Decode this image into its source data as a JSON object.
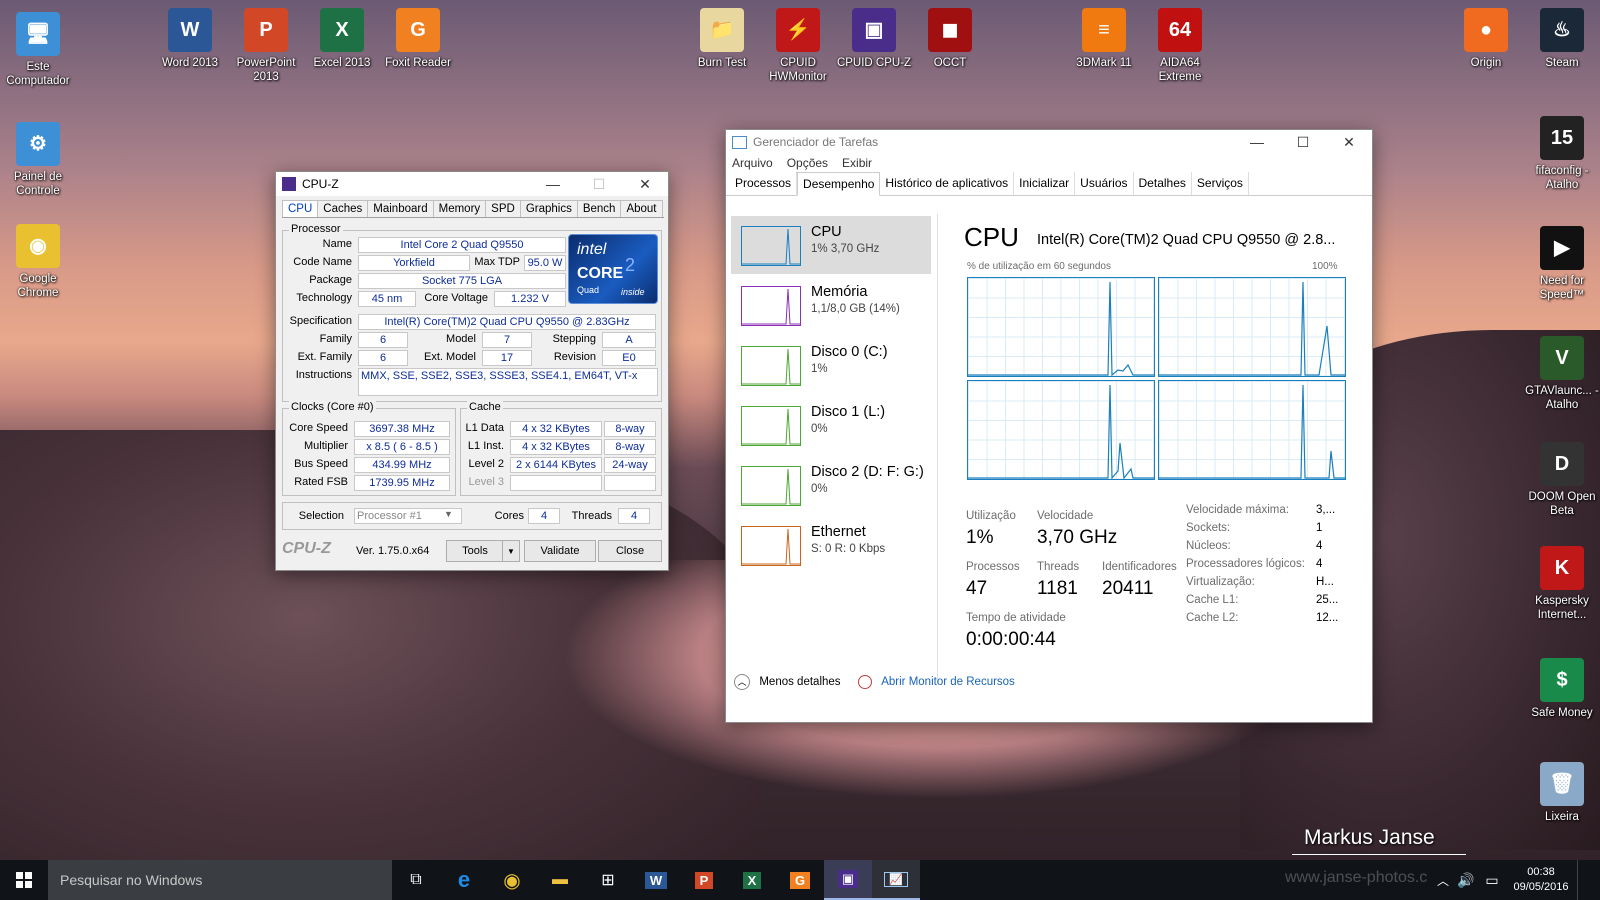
{
  "desktop_left": [
    {
      "label": "Este Computador",
      "color": "#3d8fd6",
      "glyph": "🖥",
      "icon": "computer-icon"
    },
    {
      "label": "Painel de Controle",
      "color": "#3d8fd6",
      "glyph": "⚙",
      "icon": "control-panel-icon"
    },
    {
      "label": "Google Chrome",
      "color": "#e8c030",
      "glyph": "◉",
      "icon": "chrome-icon"
    }
  ],
  "desktop_top": [
    {
      "label": "Word 2013",
      "color": "#2b5797",
      "glyph": "W",
      "icon": "word-icon"
    },
    {
      "label": "PowerPoint 2013",
      "color": "#d24726",
      "glyph": "P",
      "icon": "powerpoint-icon"
    },
    {
      "label": "Excel 2013",
      "color": "#1e7145",
      "glyph": "X",
      "icon": "excel-icon"
    },
    {
      "label": "Foxit Reader",
      "color": "#f08020",
      "glyph": "G",
      "icon": "foxit-icon"
    },
    {
      "label": "Burn Test",
      "color": "#e8d8a0",
      "glyph": "📁",
      "icon": "folder-icon"
    },
    {
      "label": "CPUID HWMonitor",
      "color": "#c01818",
      "glyph": "⚡",
      "icon": "hwmonitor-icon"
    },
    {
      "label": "CPUID CPU-Z",
      "color": "#4a2d8a",
      "glyph": "▣",
      "icon": "cpuz-icon"
    },
    {
      "label": "OCCT",
      "color": "#a01010",
      "glyph": "◼",
      "icon": "occt-icon"
    },
    {
      "label": "3DMark 11",
      "color": "#f07a10",
      "glyph": "≡",
      "icon": "3dmark-icon"
    },
    {
      "label": "AIDA64 Extreme",
      "color": "#c01010",
      "glyph": "64",
      "icon": "aida64-icon"
    },
    {
      "label": "Origin",
      "color": "#f06a20",
      "glyph": "●",
      "icon": "origin-icon"
    },
    {
      "label": "Steam",
      "color": "#1b2838",
      "glyph": "♨",
      "icon": "steam-icon"
    }
  ],
  "desktop_right": [
    {
      "label": "fifaconfig - Atalho",
      "color": "#222",
      "glyph": "15",
      "icon": "fifa-icon"
    },
    {
      "label": "Need for Speed™",
      "color": "#111",
      "glyph": "▶",
      "icon": "nfs-icon"
    },
    {
      "label": "GTAVlaunc... - Atalho",
      "color": "#2a5a2a",
      "glyph": "V",
      "icon": "gta-icon"
    },
    {
      "label": "DOOM Open Beta",
      "color": "#333",
      "glyph": "D",
      "icon": "doom-icon"
    },
    {
      "label": "Kaspersky Internet...",
      "color": "#c01818",
      "glyph": "K",
      "icon": "kaspersky-icon"
    },
    {
      "label": "Safe Money",
      "color": "#1a8a4a",
      "glyph": "$",
      "icon": "safe-money-icon"
    },
    {
      "label": "Lixeira",
      "color": "#8aa8c8",
      "glyph": "🗑",
      "icon": "recycle-bin-icon"
    }
  ],
  "cpuz": {
    "title": "CPU-Z",
    "tabs": [
      "CPU",
      "Caches",
      "Mainboard",
      "Memory",
      "SPD",
      "Graphics",
      "Bench",
      "About"
    ],
    "processor_legend": "Processor",
    "name_l": "Name",
    "name_v": "Intel Core 2 Quad Q9550",
    "codename_l": "Code Name",
    "codename_v": "Yorkfield",
    "maxtdp_l": "Max TDP",
    "maxtdp_v": "95.0 W",
    "package_l": "Package",
    "package_v": "Socket 775 LGA",
    "tech_l": "Technology",
    "tech_v": "45 nm",
    "voltage_l": "Core Voltage",
    "voltage_v": "1.232 V",
    "spec_l": "Specification",
    "spec_v": "Intel(R) Core(TM)2 Quad CPU    Q9550  @ 2.83GHz",
    "family_l": "Family",
    "family_v": "6",
    "model_l": "Model",
    "model_v": "7",
    "stepping_l": "Stepping",
    "stepping_v": "A",
    "extfamily_l": "Ext. Family",
    "extfamily_v": "6",
    "extmodel_l": "Ext. Model",
    "extmodel_v": "17",
    "revision_l": "Revision",
    "revision_v": "E0",
    "instr_l": "Instructions",
    "instr_v": "MMX, SSE, SSE2, SSE3, SSSE3, SSE4.1, EM64T, VT-x",
    "logo_intel": "intel",
    "logo_core": "CORE",
    "logo_2": "2",
    "logo_quad": "Quad",
    "logo_inside": "inside",
    "clocks_legend": "Clocks (Core #0)",
    "corespeed_l": "Core Speed",
    "corespeed_v": "3697.38 MHz",
    "multiplier_l": "Multiplier",
    "multiplier_v": "x 8.5  ( 6 - 8.5 )",
    "busspeed_l": "Bus Speed",
    "busspeed_v": "434.99 MHz",
    "ratedfsb_l": "Rated FSB",
    "ratedfsb_v": "1739.95 MHz",
    "cache_legend": "Cache",
    "l1d_l": "L1 Data",
    "l1d_v": "4 x 32 KBytes",
    "l1d_w": "8-way",
    "l1i_l": "L1 Inst.",
    "l1i_v": "4 x 32 KBytes",
    "l1i_w": "8-way",
    "l2_l": "Level 2",
    "l2_v": "2 x 6144 KBytes",
    "l2_w": "24-way",
    "l3_l": "Level 3",
    "selection_l": "Selection",
    "selection_v": "Processor #1",
    "cores_l": "Cores",
    "cores_v": "4",
    "threads_l": "Threads",
    "threads_v": "4",
    "brand": "CPU-Z",
    "version": "Ver. 1.75.0.x64",
    "tools_btn": "Tools",
    "validate_btn": "Validate",
    "close_btn": "Close"
  },
  "tm": {
    "title": "Gerenciador de Tarefas",
    "menu": [
      "Arquivo",
      "Opções",
      "Exibir"
    ],
    "tabs": [
      "Processos",
      "Desempenho",
      "Histórico de aplicativos",
      "Inicializar",
      "Usuários",
      "Detalhes",
      "Serviços"
    ],
    "resources": [
      {
        "name": "CPU",
        "sub": "1% 3,70 GHz",
        "color": "#1a7fbf"
      },
      {
        "name": "Memória",
        "sub": "1,1/8,0 GB (14%)",
        "color": "#8b2fb5"
      },
      {
        "name": "Disco 0 (C:)",
        "sub": "1%",
        "color": "#4da633"
      },
      {
        "name": "Disco 1 (L:)",
        "sub": "0%",
        "color": "#4da633"
      },
      {
        "name": "Disco 2 (D: F: G:)",
        "sub": "0%",
        "color": "#4da633"
      },
      {
        "name": "Ethernet",
        "sub": "S: 0 R: 0 Kbps",
        "color": "#c8641e"
      }
    ],
    "cpu_title": "CPU",
    "cpu_model": "Intel(R) Core(TM)2 Quad CPU Q9550 @ 2.8...",
    "graph_label": "% de utilização em 60 segundos",
    "graph_max": "100%",
    "util_l": "Utilização",
    "util_v": "1%",
    "speed_l": "Velocidade",
    "speed_v": "3,70 GHz",
    "proc_l": "Processos",
    "proc_v": "47",
    "threads_l": "Threads",
    "threads_v": "1181",
    "handles_l": "Identificadores",
    "handles_v": "20411",
    "uptime_l": "Tempo de atividade",
    "uptime_v": "0:00:00:44",
    "details": [
      {
        "k": "Velocidade máxima:",
        "v": "3,..."
      },
      {
        "k": "Sockets:",
        "v": "1"
      },
      {
        "k": "Núcleos:",
        "v": "4"
      },
      {
        "k": "Processadores lógicos:",
        "v": "4"
      },
      {
        "k": "Virtualização:",
        "v": "H..."
      },
      {
        "k": "Cache L1:",
        "v": "25..."
      },
      {
        "k": "Cache L2:",
        "v": "12..."
      }
    ],
    "less_details": "Menos detalhes",
    "open_monitor": "Abrir Monitor de Recursos"
  },
  "watermark": {
    "name": "Markus Janse",
    "url": "www.janse-photos.c"
  },
  "taskbar": {
    "search_placeholder": "Pesquisar no Windows",
    "time": "00:38",
    "date": "09/05/2016"
  }
}
